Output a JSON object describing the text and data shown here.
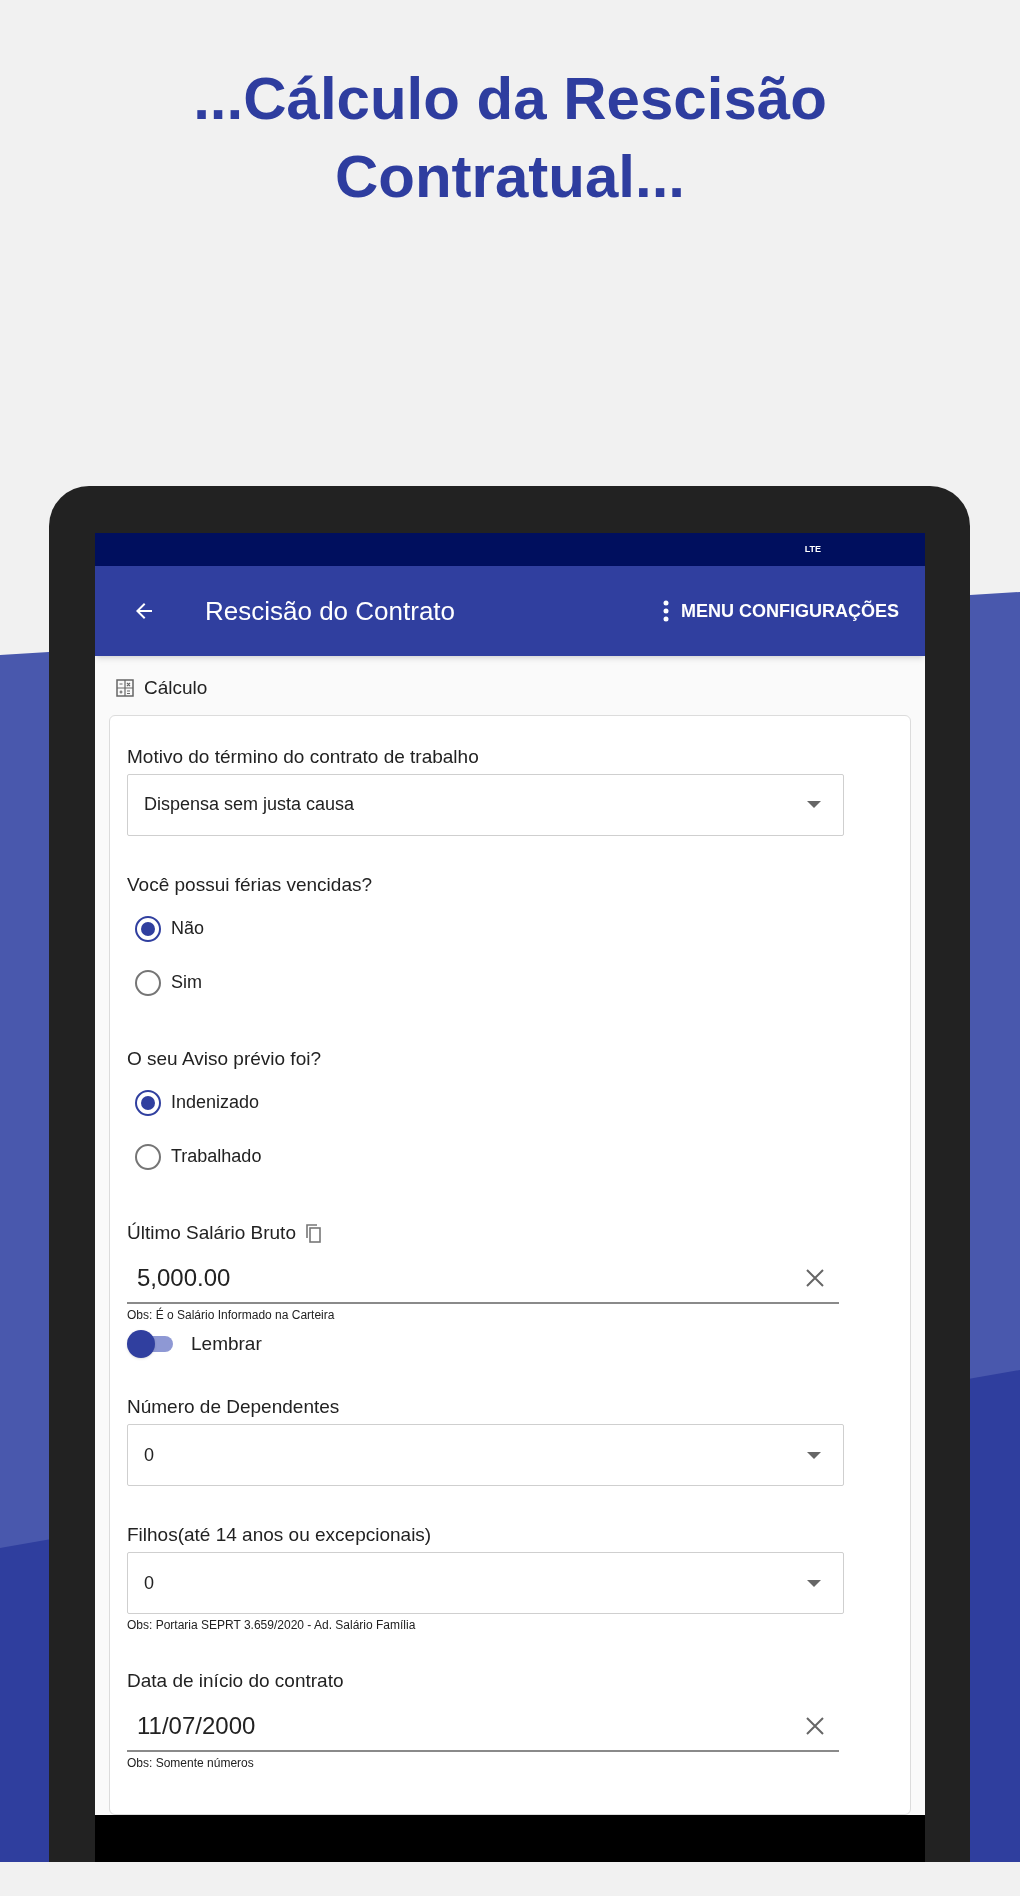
{
  "headline_lines": [
    "...Cálculo da Rescisão",
    "Contratual..."
  ],
  "status_bar": {
    "network": "LTE"
  },
  "app_bar": {
    "title": "Rescisão do Contrato",
    "menu_label": "MENU CONFIGURAÇÕES"
  },
  "section": {
    "title": "Cálculo"
  },
  "fields": [
    {
      "kind": "select",
      "label": "Motivo do término do contrato de trabalho",
      "value": "Dispensa sem justa causa"
    },
    {
      "kind": "radio",
      "label": "Você possui férias vencidas?",
      "options": [
        {
          "label": "Não",
          "selected": true
        },
        {
          "label": "Sim",
          "selected": false
        }
      ]
    },
    {
      "kind": "radio",
      "label": "O seu Aviso prévio foi?",
      "options": [
        {
          "label": "Indenizado",
          "selected": true
        },
        {
          "label": "Trabalhado",
          "selected": false
        }
      ]
    },
    {
      "kind": "text",
      "label": "Último Salário Bruto",
      "copy_icon": true,
      "value": "5,000.00",
      "hint": "Obs: É o Salário Informado na Carteira"
    },
    {
      "kind": "switch",
      "label": "Lembrar",
      "on": false
    },
    {
      "kind": "select",
      "label": "Número de Dependentes",
      "value": "0"
    },
    {
      "kind": "select",
      "label": "Filhos(até 14 anos ou excepcionais)",
      "value": "0",
      "hint": "Obs: Portaria SEPRT 3.659/2020 - Ad. Salário Família"
    },
    {
      "kind": "text",
      "label": "Data de início do contrato",
      "value": "11/07/2000",
      "hint": "Obs: Somente números"
    }
  ]
}
